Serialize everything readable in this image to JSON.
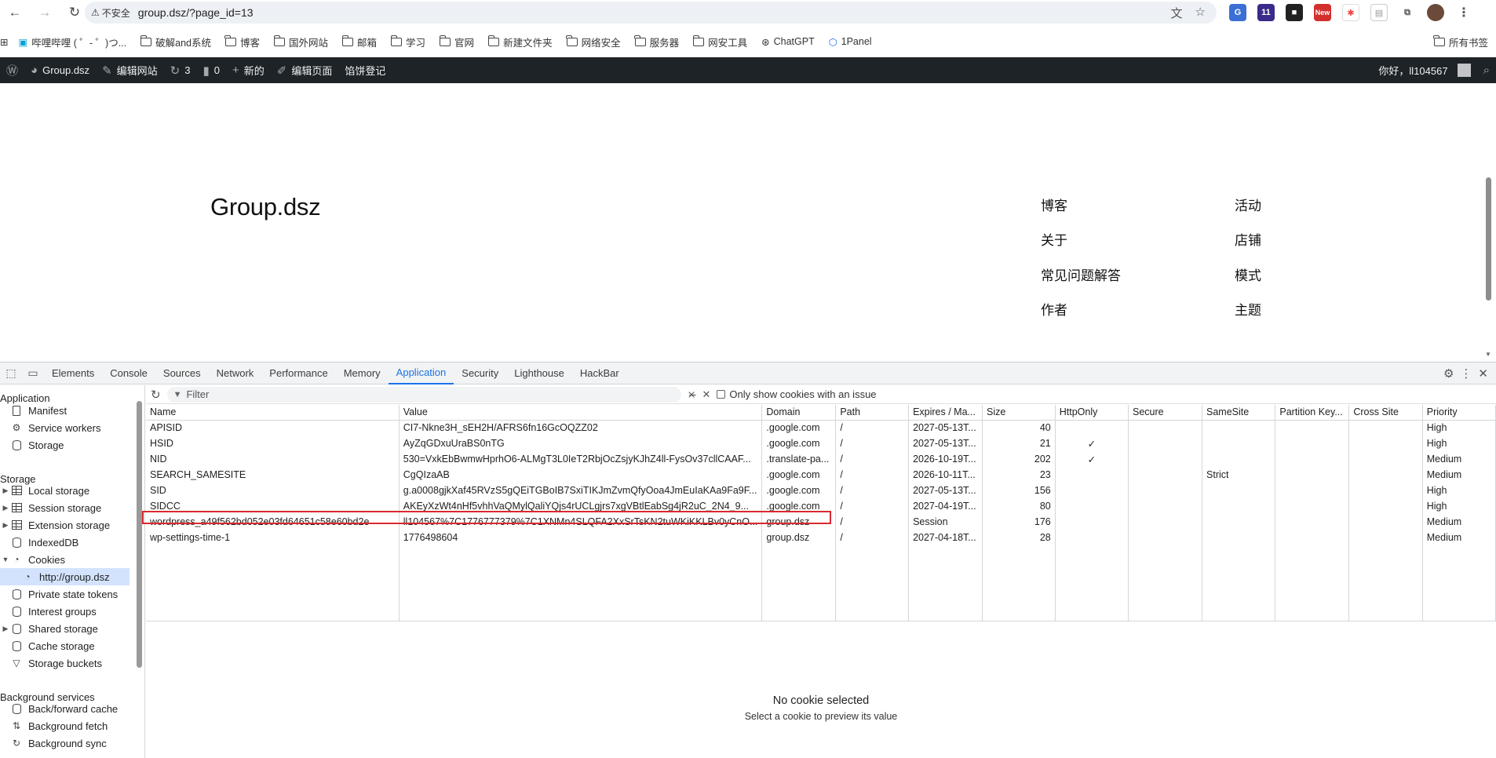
{
  "browser": {
    "security_label": "不安全",
    "url": "group.dsz/?page_id=13",
    "ext_badge": "11",
    "ext_new": "New"
  },
  "bookmarks": {
    "items": [
      "哔哩哔哩 ( ゜- ゜)つ...",
      "破解and系统",
      "博客",
      "国外网站",
      "邮箱",
      "学习",
      "官网",
      "新建文件夹",
      "网络安全",
      "服务器",
      "网安工具",
      "ChatGPT",
      "1Panel"
    ],
    "all": "所有书签"
  },
  "wpbar": {
    "site": "Group.dsz",
    "customize": "编辑网站",
    "updates": "3",
    "comments": "0",
    "new": "新的",
    "edit": "编辑页面",
    "cookie": "馅饼登记",
    "greeting": "你好，ll104567"
  },
  "page": {
    "title": "Group.dsz",
    "menu_left": [
      "博客",
      "关于",
      "常见问题解答",
      "作者"
    ],
    "menu_right": [
      "活动",
      "店铺",
      "模式",
      "主题"
    ]
  },
  "devtools": {
    "tabs": [
      "Elements",
      "Console",
      "Sources",
      "Network",
      "Performance",
      "Memory",
      "Application",
      "Security",
      "Lighthouse",
      "HackBar"
    ],
    "active_tab": "Application",
    "sidebar": {
      "app_header": "Application",
      "app_items": [
        "Manifest",
        "Service workers",
        "Storage"
      ],
      "storage_header": "Storage",
      "storage_items": [
        "Local storage",
        "Session storage",
        "Extension storage",
        "IndexedDB",
        "Cookies",
        "http://group.dsz",
        "Private state tokens",
        "Interest groups",
        "Shared storage",
        "Cache storage",
        "Storage buckets"
      ],
      "bg_header": "Background services",
      "bg_items": [
        "Back/forward cache",
        "Background fetch",
        "Background sync"
      ]
    },
    "filter_placeholder": "Filter",
    "only_issues_label": "Only show cookies with an issue",
    "columns": [
      "Name",
      "Value",
      "Domain",
      "Path",
      "Expires / Ma...",
      "Size",
      "HttpOnly",
      "Secure",
      "SameSite",
      "Partition Key...",
      "Cross Site",
      "Priority"
    ],
    "cookies": [
      [
        "APISID",
        "CI7-Nkne3H_sEH2H/AFRS6fn16GcOQZZ02",
        ".google.com",
        "/",
        "2027-05-13T...",
        "40",
        "",
        "",
        "",
        "",
        "",
        "High"
      ],
      [
        "HSID",
        "AyZqGDxuUraBS0nTG",
        ".google.com",
        "/",
        "2027-05-13T...",
        "21",
        "✓",
        "",
        "",
        "",
        "",
        "High"
      ],
      [
        "NID",
        "530=VxkEbBwmwHprhO6-ALMgT3L0IeT2RbjOcZsjyKJhZ4ll-FysOv37cllCAAF...",
        ".translate-pa...",
        "/",
        "2026-10-19T...",
        "202",
        "✓",
        "",
        "",
        "",
        "",
        "Medium"
      ],
      [
        "SEARCH_SAMESITE",
        "CgQIzaAB",
        ".google.com",
        "/",
        "2026-10-11T...",
        "23",
        "",
        "",
        "Strict",
        "",
        "",
        "Medium"
      ],
      [
        "SID",
        "g.a0008gjkXaf45RVzS5gQEiTGBoIB7SxiTIKJmZvmQfyOoa4JmEuIaKAa9Fa9F...",
        ".google.com",
        "/",
        "2027-05-13T...",
        "156",
        "",
        "",
        "",
        "",
        "",
        "High"
      ],
      [
        "SIDCC",
        "AKEyXzWt4nHf5vhhVaQMylQaliYQjs4rUCLgjrs7xgVBtlEabSg4jR2uC_2N4_9...",
        ".google.com",
        "/",
        "2027-04-19T...",
        "80",
        "",
        "",
        "",
        "",
        "",
        "High"
      ],
      [
        "wordpress_a49f562bd052e03fd64651c58e60bd2e",
        "ll104567%7C1776777379%7C1XNMn4SLQFA2XxSrTsKN2tuWKiKKLBv0yCnO...",
        "group.dsz",
        "/",
        "Session",
        "176",
        "",
        "",
        "",
        "",
        "",
        "Medium"
      ],
      [
        "wp-settings-time-1",
        "1776498604",
        "group.dsz",
        "/",
        "2027-04-18T...",
        "28",
        "",
        "",
        "",
        "",
        "",
        "Medium"
      ]
    ],
    "preview_title": "No cookie selected",
    "preview_sub": "Select a cookie to preview its value"
  }
}
